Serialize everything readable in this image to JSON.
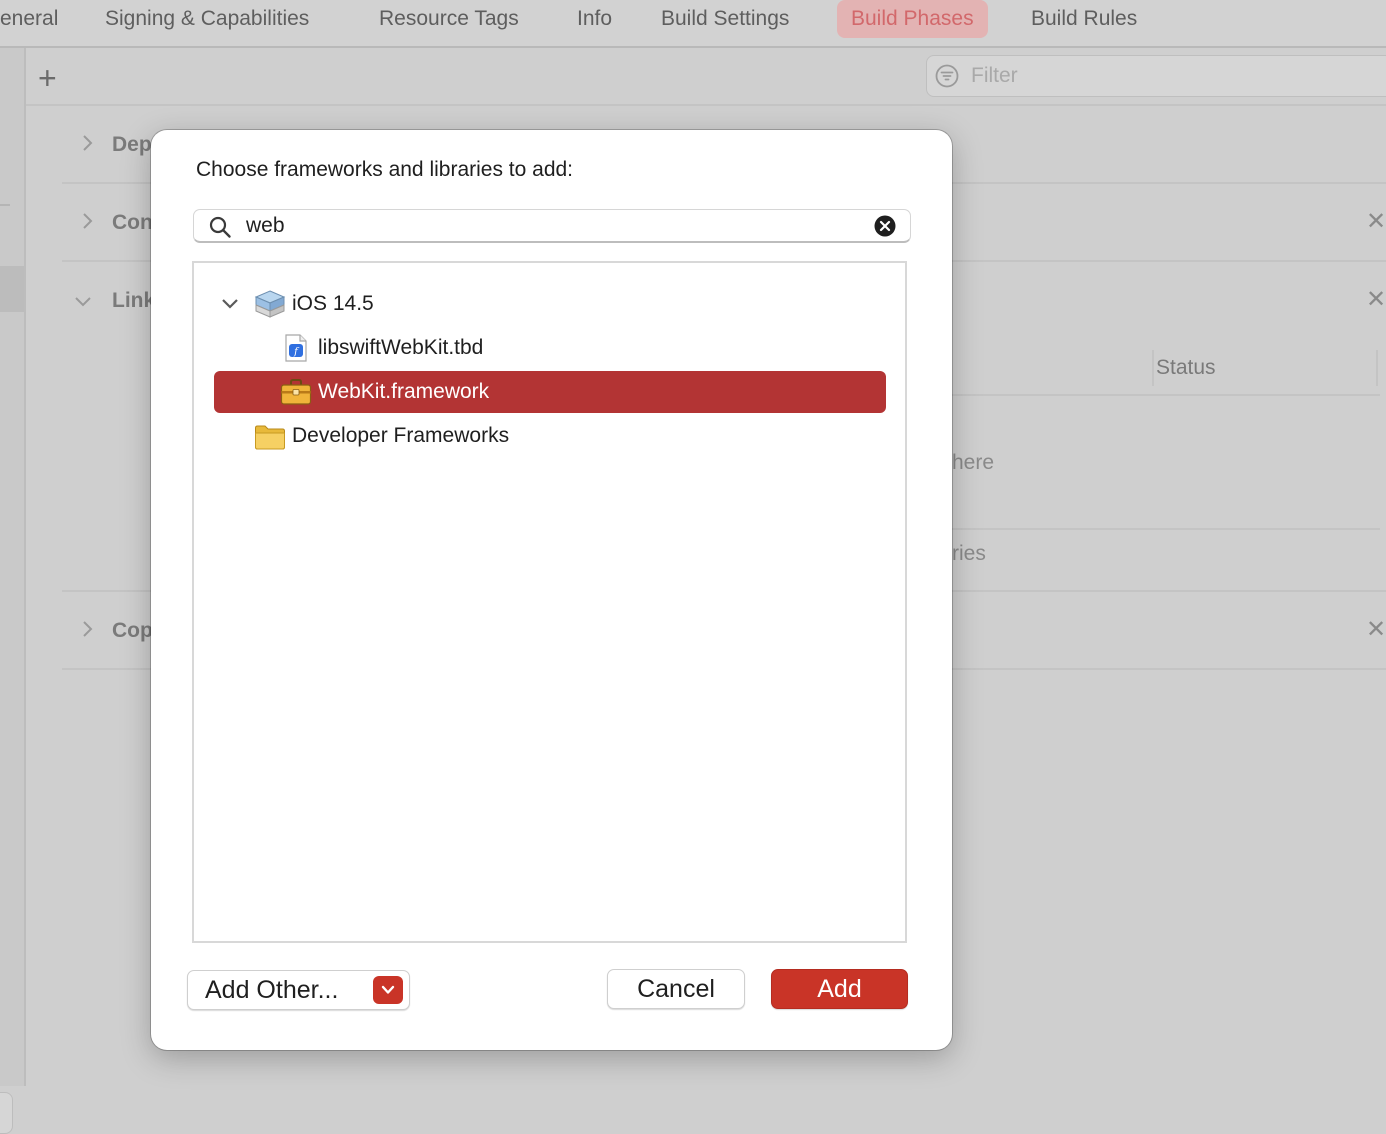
{
  "tabs": [
    {
      "label": "eneral"
    },
    {
      "label": "Signing & Capabilities"
    },
    {
      "label": "Resource Tags"
    },
    {
      "label": "Info"
    },
    {
      "label": "Build Settings"
    },
    {
      "label": "Build Phases"
    },
    {
      "label": "Build Rules"
    }
  ],
  "active_tab": "Build Phases",
  "toolbar": {
    "add_symbol": "+",
    "filter_placeholder": "Filter"
  },
  "phases": [
    {
      "label": "Dep"
    },
    {
      "label": "Con"
    },
    {
      "label": "Link"
    },
    {
      "label": "Cop"
    }
  ],
  "link_table": {
    "status_header": "Status",
    "fragment_1": "here",
    "fragment_2": "ries"
  },
  "dialog": {
    "title": "Choose frameworks and libraries to add:",
    "search_value": "web",
    "tree": [
      {
        "label": "iOS 14.5",
        "icon": "sdk-icon"
      },
      {
        "label": "libswiftWebKit.tbd",
        "icon": "tbd-file-icon"
      },
      {
        "label": "WebKit.framework",
        "icon": "framework-toolbox-icon",
        "selected": true
      },
      {
        "label": "Developer Frameworks",
        "icon": "folder-icon"
      }
    ],
    "add_other_label": "Add Other...",
    "cancel_label": "Cancel",
    "add_label": "Add"
  },
  "colors": {
    "accent": "#c93427",
    "selection": "#b33434",
    "active_tab_bg": "#e3b3b3",
    "active_tab_text": "#d2686b"
  }
}
